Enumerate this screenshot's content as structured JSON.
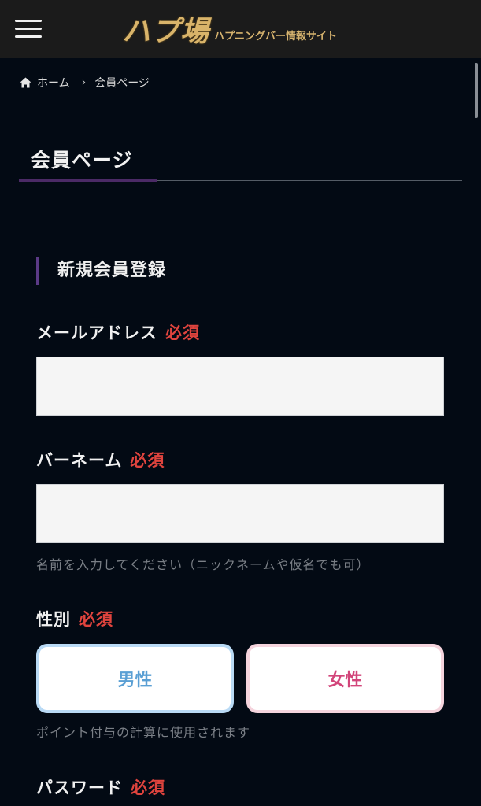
{
  "header": {
    "logo_main": "ハプ場",
    "logo_sub": "ハプニングバー情報サイト"
  },
  "breadcrumb": {
    "home": "ホーム",
    "separator": "›",
    "current": "会員ページ"
  },
  "page_title": "会員ページ",
  "section_heading": "新規会員登録",
  "form": {
    "email": {
      "label": "メールアドレス",
      "required": "必須",
      "value": "",
      "placeholder": ""
    },
    "barname": {
      "label": "バーネーム",
      "required": "必須",
      "value": "",
      "placeholder": "",
      "help": "名前を入力してください（ニックネームや仮名でも可）"
    },
    "gender": {
      "label": "性別",
      "required": "必須",
      "male": "男性",
      "female": "女性",
      "help": "ポイント付与の計算に使用されます"
    },
    "password": {
      "label": "パスワード",
      "required": "必須"
    }
  },
  "colors": {
    "background": "#030a14",
    "header": "#1b1b1b",
    "required": "#e0443e",
    "accent": "#5b3a86",
    "male": "#5a9fd4",
    "female": "#d2457a"
  }
}
